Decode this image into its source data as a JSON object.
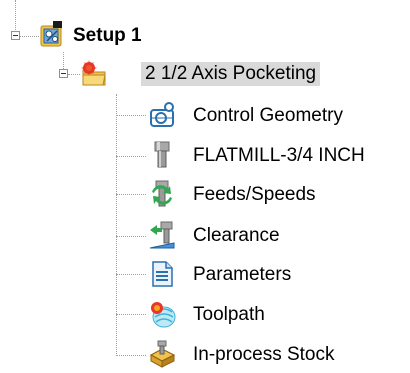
{
  "tree": {
    "setup": {
      "label": "Setup 1",
      "icon": "setup-icon"
    },
    "operation": {
      "label": "2 1/2 Axis Pocketing",
      "icon": "operation-folder-icon",
      "selected": true
    },
    "children": [
      {
        "label": "Control Geometry",
        "icon": "control-geometry-icon"
      },
      {
        "label": "FLATMILL-3/4 INCH",
        "icon": "flatmill-tool-icon"
      },
      {
        "label": "Feeds/Speeds",
        "icon": "feeds-speeds-icon"
      },
      {
        "label": "Clearance",
        "icon": "clearance-icon"
      },
      {
        "label": "Parameters",
        "icon": "parameters-icon"
      },
      {
        "label": "Toolpath",
        "icon": "toolpath-icon"
      },
      {
        "label": "In-process Stock",
        "icon": "in-process-stock-icon"
      }
    ]
  },
  "colors": {
    "selection_bg": "#d9d9d9",
    "tree_line": "#a0a0a0"
  }
}
